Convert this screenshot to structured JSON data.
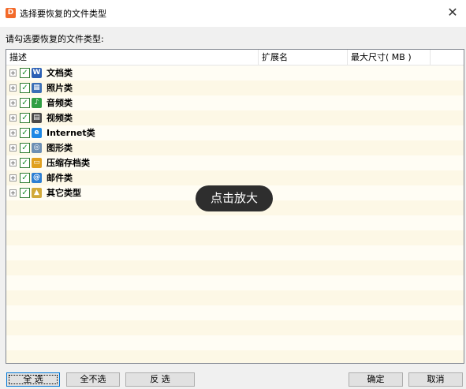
{
  "window": {
    "title": "选择要恢复的文件类型",
    "app_icon_glyph": "D",
    "close_glyph": "✕"
  },
  "prompt": "请勾选要恢复的文件类型:",
  "columns": {
    "description": "描述",
    "extension": "扩展名",
    "max_size": "最大尺寸( MB )"
  },
  "file_types": [
    {
      "label": "文档类",
      "checked": true,
      "icon": "word-doc-icon",
      "icon_glyph": "W",
      "icon_color": "#2b5fb4"
    },
    {
      "label": "照片类",
      "checked": true,
      "icon": "photo-icon",
      "icon_glyph": "▦",
      "icon_color": "#3b6fb6"
    },
    {
      "label": "音频类",
      "checked": true,
      "icon": "audio-icon",
      "icon_glyph": "♪",
      "icon_color": "#2f9e44"
    },
    {
      "label": "视频类",
      "checked": true,
      "icon": "video-film-icon",
      "icon_glyph": "▤",
      "icon_color": "#4a4a4a"
    },
    {
      "label": "Internet类",
      "checked": true,
      "icon": "internet-explorer-icon",
      "icon_glyph": "e",
      "icon_color": "#1e88e5"
    },
    {
      "label": "图形类",
      "checked": true,
      "icon": "graphics-icon",
      "icon_glyph": "◎",
      "icon_color": "#6d8fb3"
    },
    {
      "label": "压缩存档类",
      "checked": true,
      "icon": "archive-icon",
      "icon_glyph": "▭",
      "icon_color": "#e0a020"
    },
    {
      "label": "邮件类",
      "checked": true,
      "icon": "mail-icon",
      "icon_glyph": "@",
      "icon_color": "#2d7fd3"
    },
    {
      "label": "其它类型",
      "checked": true,
      "icon": "other-file-icon",
      "icon_glyph": "▲",
      "icon_color": "#d1a93a"
    }
  ],
  "tooltip": "点击放大",
  "buttons": {
    "select_all": "全 选",
    "select_none": "全不选",
    "invert": "反 选",
    "ok": "确定",
    "cancel": "取消"
  }
}
